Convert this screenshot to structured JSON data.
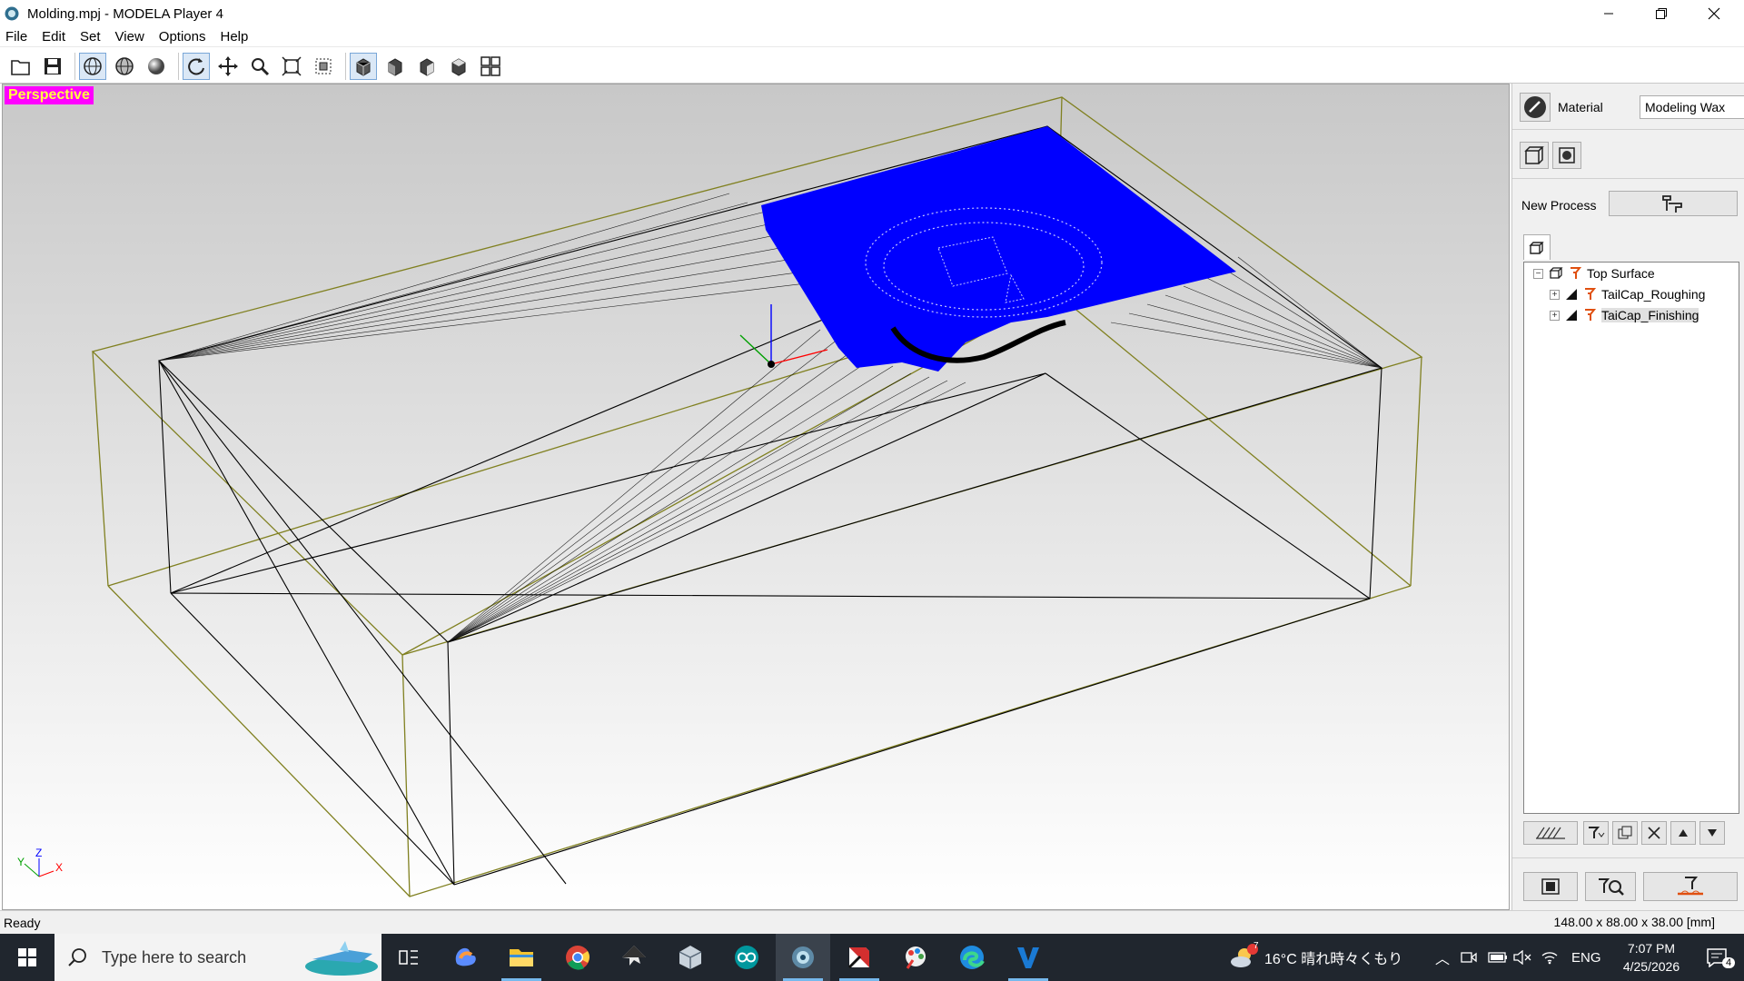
{
  "window": {
    "title": "Molding.mpj - MODELA Player 4",
    "controls": [
      "minimize-icon",
      "restore-icon",
      "close-icon"
    ]
  },
  "menu": [
    "File",
    "Edit",
    "Set",
    "View",
    "Options",
    "Help"
  ],
  "toolbar": {
    "buttons": [
      "open-icon",
      "save-icon",
      "wireframe-icon",
      "ghost-icon",
      "shaded-icon",
      "rotate-icon",
      "pan-icon",
      "zoom-icon",
      "fit-icon",
      "zoom-box-icon",
      "view-perspective-icon",
      "view-front-icon",
      "view-side-icon",
      "view-top-icon",
      "view-multi-icon"
    ],
    "selected": [
      "wireframe-icon",
      "rotate-icon",
      "view-perspective-icon"
    ]
  },
  "viewport": {
    "mode_label": "Perspective",
    "triad": {
      "y": "Y",
      "z": "Z",
      "x": "X"
    },
    "colors": {
      "mode_bg": "#ff00ff",
      "mode_text": "#ffff40",
      "workpiece": "#808020",
      "surface": "#0000ff"
    }
  },
  "panel": {
    "material_label": "Material",
    "material_value": "Modeling Wax",
    "new_process_label": "New Process",
    "tree": [
      {
        "label": "Top Surface",
        "level": 0,
        "expander": "−"
      },
      {
        "label": "TailCap_Roughing",
        "level": 1,
        "expander": "+"
      },
      {
        "label": "TaiCap_Finishing",
        "level": 1,
        "expander": "+"
      }
    ]
  },
  "status": {
    "text": "Ready",
    "dimensions": "148.00 x 88.00 x 38.00 [mm]"
  },
  "taskbar": {
    "search_placeholder": "Type here to search",
    "weather": "16°C  晴れ時々くもり",
    "weather_badge": "7",
    "language": "ENG",
    "time": "7:07 PM",
    "date": "4/25/2026",
    "notifications": "4",
    "apps": [
      "task-view-icon",
      "copilot-icon",
      "file-explorer-icon",
      "chrome-icon",
      "inkscape-icon",
      "3d-viewer-icon",
      "arduino-icon",
      "modela-player-icon",
      "app-red-icon",
      "app-paint-icon",
      "edge-icon",
      "vpanel-icon"
    ]
  }
}
